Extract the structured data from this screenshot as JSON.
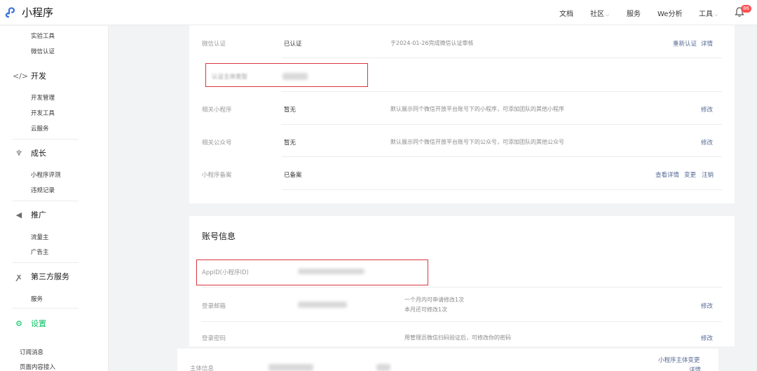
{
  "app": {
    "logo_text": "小程序"
  },
  "topnav": {
    "docs": "文档",
    "community": "社区",
    "services": "服务",
    "we_analysis": "We分析",
    "tools": "工具",
    "notification_count": "86"
  },
  "sidebar": {
    "items_top": [
      "实验工具",
      "微信认证"
    ],
    "groups": [
      {
        "label": "开发",
        "items": [
          "开发管理",
          "开发工具",
          "云服务"
        ]
      },
      {
        "label": "成长",
        "items": [
          "小程序评测",
          "违规记录"
        ]
      },
      {
        "label": "推广",
        "items": [
          "流量主",
          "广告主"
        ]
      },
      {
        "label": "第三方服务",
        "items": [
          "服务"
        ]
      },
      {
        "label": "设置",
        "items": []
      }
    ],
    "items_bottom": [
      "订阅消息",
      "页面内容接入"
    ]
  },
  "info_rows": [
    {
      "label": "微信认证",
      "value": "已认证",
      "desc": "于2024-01-26完成微信认证审核",
      "links": [
        "重新认证",
        "详情"
      ]
    },
    {
      "label": "认证主体类型",
      "value": "",
      "desc": "",
      "links": []
    },
    {
      "label": "相关小程序",
      "value": "暂无",
      "desc": "默认展示同个微信开放平台账号下的小程序，可添加团队的其他小程序",
      "links": [
        "修改"
      ]
    },
    {
      "label": "相关公众号",
      "value": "暂无",
      "desc": "默认展示同个微信开放平台账号下的公众号，可添加团队的其他公众号",
      "links": [
        "修改"
      ]
    },
    {
      "label": "小程序备案",
      "value": "已备案",
      "desc": "",
      "links": [
        "查看详情",
        "变更",
        "注销"
      ]
    }
  ],
  "account": {
    "title": "账号信息",
    "rows": [
      {
        "label": "AppID(小程序ID)",
        "value": "",
        "desc": "",
        "links": []
      },
      {
        "label": "登录邮箱",
        "value": "",
        "desc_lines": [
          "一个月内可申请修改1次",
          "本月还可修改1次"
        ],
        "links": [
          "修改"
        ]
      },
      {
        "label": "登录密码",
        "value": "",
        "desc": "用管理员微信扫码验证后，可修改你的密码",
        "links": [
          "修改"
        ]
      },
      {
        "label": "主体信息",
        "value": "",
        "desc": "",
        "links": [
          "小程序主体变更",
          "详情"
        ]
      }
    ]
  },
  "colors": {
    "link": "#576b95",
    "badge": "#fa5151",
    "active_green": "#07c160",
    "highlight_red": "#d9363e"
  }
}
